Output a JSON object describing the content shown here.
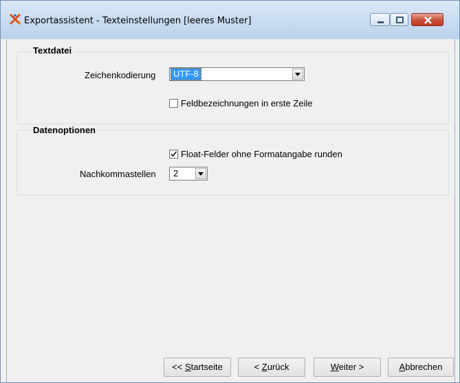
{
  "window": {
    "title": "Exportassistent - Texteinstellungen [leeres Muster]"
  },
  "icons": {
    "app": "cross-arrows-app-icon",
    "minimize": "minimize-icon",
    "maximize": "maximize-icon",
    "close": "close-icon",
    "dropdown": "chevron-down-icon",
    "checkmark": "checkmark-icon"
  },
  "textdatei": {
    "legend": "Textdatei",
    "encoding_label": "Zeichenkodierung",
    "encoding_value": "UTF-8",
    "header_row_label": "Feldbezeichnungen in erste Zeile",
    "header_row_checked": false
  },
  "datenoptionen": {
    "legend": "Datenoptionen",
    "round_float_label": "Float-Felder ohne Formatangabe runden",
    "round_float_checked": true,
    "decimals_label": "Nachkommastellen",
    "decimals_value": "2"
  },
  "buttons": {
    "start_prefix": "<< ",
    "start_mnemonic": "S",
    "start_rest": "tartseite",
    "back_prefix": "< ",
    "back_mnemonic": "Z",
    "back_rest": "urück",
    "next_mnemonic": "W",
    "next_rest": "eiter >",
    "cancel_mnemonic": "A",
    "cancel_rest": "bbrechen"
  },
  "colors": {
    "selection": "#3399ff",
    "close_button": "#c8513a",
    "titlebar": "#c6daf0"
  }
}
